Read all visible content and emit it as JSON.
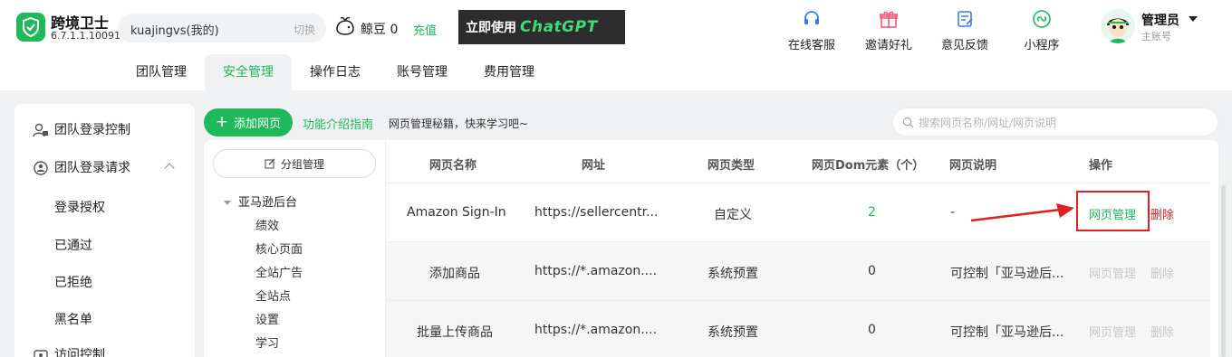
{
  "app": {
    "name": "跨境卫士",
    "version": "6.7.1.1.10091"
  },
  "account": {
    "name": "kuajingvs(我的)",
    "switch_label": "切换"
  },
  "beans": {
    "label": "鲸豆 0",
    "recharge_label": "充值"
  },
  "banner": {
    "text": "立即使用",
    "brand": "ChatGPT"
  },
  "top_actions": [
    {
      "label": "在线客服",
      "icon": "headset-icon"
    },
    {
      "label": "邀请好礼",
      "icon": "gift-icon"
    },
    {
      "label": "意见反馈",
      "icon": "feedback-icon"
    },
    {
      "label": "小程序",
      "icon": "mini-program-icon"
    }
  ],
  "user": {
    "name": "管理员",
    "role": "主账号"
  },
  "tabs": [
    {
      "label": "团队管理",
      "active": false
    },
    {
      "label": "安全管理",
      "active": true
    },
    {
      "label": "操作日志",
      "active": false
    },
    {
      "label": "账号管理",
      "active": false
    },
    {
      "label": "费用管理",
      "active": false
    }
  ],
  "sidebar": {
    "items": [
      {
        "label": "团队登录控制",
        "icon": "user-lock-icon"
      },
      {
        "label": "团队登录请求",
        "icon": "request-icon"
      },
      {
        "label": "访问控制",
        "icon": "access-icon"
      }
    ],
    "sub_items": [
      "登录授权",
      "已通过",
      "已拒绝",
      "黑名单"
    ]
  },
  "toolbar": {
    "add_label": "添加网页",
    "guide_label": "功能介绍指南",
    "guide_text": "网页管理秘籍，快来学习吧~",
    "search_placeholder": "搜索网页名称/网址/网页说明"
  },
  "groups": {
    "manage_label": "分组管理",
    "root": "亚马逊后台",
    "children": [
      "绩效",
      "核心页面",
      "全站广告",
      "全站点",
      "设置",
      "学习"
    ]
  },
  "table": {
    "headers": [
      "网页名称",
      "网址",
      "网页类型",
      "网页Dom元素（个）",
      "网页说明",
      "操作"
    ],
    "rows": [
      {
        "name": "Amazon Sign-In",
        "url": "https://sellercentr...",
        "type": "自定义",
        "dom": "2",
        "desc": "-",
        "manage": "网页管理",
        "delete": "删除"
      },
      {
        "name": "添加商品",
        "url": "https://*.amazon....",
        "type": "系统预置",
        "dom": "0",
        "desc": "可控制「亚马逊后...",
        "manage": "网页管理",
        "delete": "删除"
      },
      {
        "name": "批量上传商品",
        "url": "https://*.amazon....",
        "type": "系统预置",
        "dom": "0",
        "desc": "可控制「亚马逊后...",
        "manage": "网页管理",
        "delete": "删除"
      }
    ]
  },
  "colors": {
    "brand": "#1fb85b",
    "highlight": "#e02020"
  }
}
